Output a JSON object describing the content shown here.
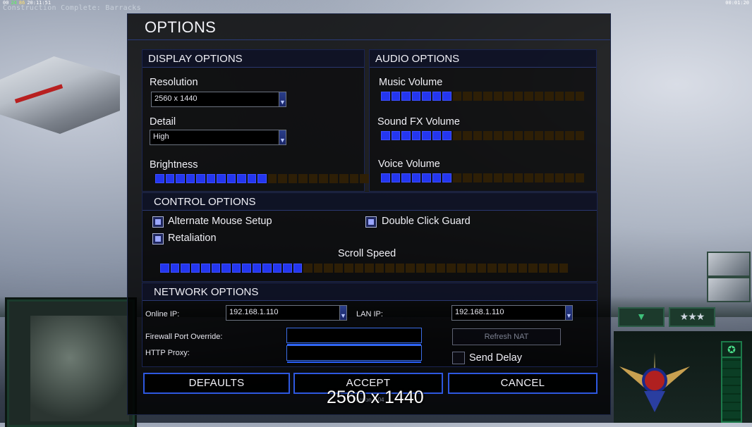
{
  "hud": {
    "stats": [
      {
        "text": "00",
        "tone": "w"
      },
      {
        "text": "24",
        "tone": "g"
      },
      {
        "text": "86",
        "tone": "y"
      },
      {
        "text": "20:11:51",
        "tone": "w"
      }
    ],
    "message": "Construction Complete: Barracks",
    "timer": "00:01:20"
  },
  "dialog": {
    "title": "OPTIONS",
    "display": {
      "header": "DISPLAY OPTIONS",
      "resolution_label": "Resolution",
      "resolution_value": "2560 x 1440",
      "detail_label": "Detail",
      "detail_value": "High",
      "brightness_label": "Brightness",
      "brightness": {
        "segments": 21,
        "level": 11
      }
    },
    "audio": {
      "header": "AUDIO OPTIONS",
      "music_label": "Music Volume",
      "music": {
        "segments": 20,
        "level": 7
      },
      "sfx_label": "Sound FX Volume",
      "sfx": {
        "segments": 20,
        "level": 7
      },
      "voice_label": "Voice Volume",
      "voice": {
        "segments": 20,
        "level": 7
      }
    },
    "control": {
      "header": "CONTROL OPTIONS",
      "alt_mouse_label": "Alternate Mouse Setup",
      "alt_mouse_checked": true,
      "double_click_label": "Double Click Guard",
      "double_click_checked": true,
      "retaliation_label": "Retaliation",
      "retaliation_checked": true,
      "scroll_label": "Scroll Speed",
      "scroll": {
        "segments": 40,
        "level": 14
      }
    },
    "network": {
      "header": "NETWORK OPTIONS",
      "online_ip_label": "Online IP:",
      "online_ip_value": "192.168.1.110",
      "lan_ip_label": "LAN IP:",
      "lan_ip_value": "192.168.1.110",
      "firewall_label": "Firewall Port Override:",
      "firewall_value": "",
      "proxy_label": "HTTP Proxy:",
      "proxy_value": "",
      "refresh_nat_label": "Refresh NAT",
      "send_delay_label": "Send Delay",
      "send_delay_checked": false
    },
    "buttons": {
      "defaults": "DEFAULTS",
      "accept": "ACCEPT",
      "cancel": "CANCEL"
    },
    "version": "Version 1.04"
  },
  "overlay_text": "2560 x 1440",
  "colors": {
    "slider_on": "#2436f0",
    "slider_off": "#2e1f06",
    "border_accent": "#2e58e0"
  }
}
